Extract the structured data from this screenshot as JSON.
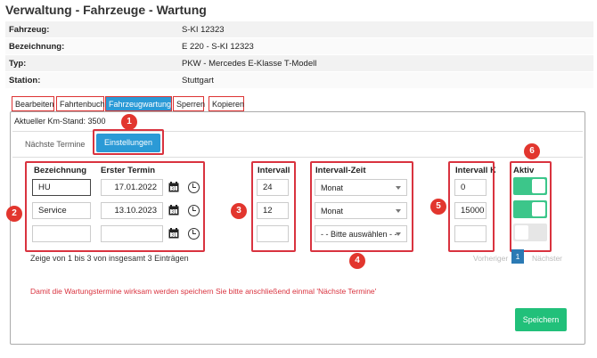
{
  "title": "Verwaltung - Fahrzeuge - Wartung",
  "info": [
    {
      "label": "Fahrzeug:",
      "value": "S-KI 12323"
    },
    {
      "label": "Bezeichnung:",
      "value": "E 220 - S-KI 12323"
    },
    {
      "label": "Typ:",
      "value": "PKW - Mercedes E-Klasse T-Modell"
    },
    {
      "label": "Station:",
      "value": "Stuttgart"
    }
  ],
  "tabs": [
    "Bearbeiten",
    "Fahrtenbuch",
    "Fahrzeugwartung",
    "Sperren",
    "Kopieren"
  ],
  "km_stand": "Aktueller Km-Stand: 3500",
  "subtabs": {
    "next": "Nächste Termine",
    "settings": "Einstellungen"
  },
  "headers": {
    "bezeichnung": "Bezeichnung",
    "erster_termin": "Erster Termin",
    "intervall": "Intervall",
    "intervall_zeit": "Intervall-Zeit",
    "intervall_km": "Intervall KM",
    "aktiv": "Aktiv"
  },
  "rows": [
    {
      "bezeichnung": "HU",
      "termin": "17.01.2022",
      "intervall": "24",
      "zeit": "Monat",
      "km": "0",
      "aktiv": true
    },
    {
      "bezeichnung": "Service",
      "termin": "13.10.2023",
      "intervall": "12",
      "zeit": "Monat",
      "km": "15000",
      "aktiv": true
    },
    {
      "bezeichnung": "",
      "termin": "",
      "intervall": "",
      "zeit": "- - Bitte auswählen - -",
      "km": "",
      "aktiv": false
    }
  ],
  "pagination": {
    "info": "Zeige von 1 bis 3 von insgesamt 3 Einträgen",
    "prev": "Vorheriger",
    "page": "1",
    "next": "Nächster"
  },
  "warning": "Damit die Wartungstermine wirksam werden speichern Sie bitte anschließend einmal 'Nächste Termine'",
  "save": "Speichern",
  "badges": [
    "1",
    "2",
    "3",
    "4",
    "5",
    "6"
  ],
  "colors": {
    "accent": "#2b9ad6",
    "success": "#3cc68a",
    "annotation": "#d9333f",
    "warning_text": "#d9333f"
  },
  "icons": {
    "calendar": "calendar-icon",
    "clock": "clock-icon"
  }
}
